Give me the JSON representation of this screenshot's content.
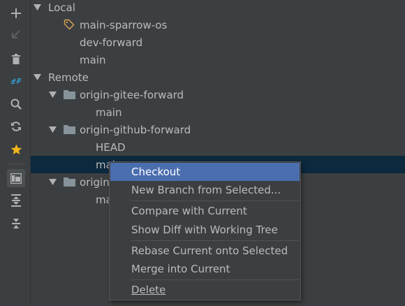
{
  "toolbar": {
    "buttons": [
      {
        "icon": "plus-icon"
      },
      {
        "icon": "arrow-down-left-icon"
      },
      {
        "icon": "trash-icon"
      },
      {
        "icon": "fetch-icon"
      },
      {
        "icon": "search-icon"
      },
      {
        "icon": "refresh-icon"
      },
      {
        "icon": "star-icon"
      },
      {
        "icon": "group-by-repository-icon"
      },
      {
        "icon": "expand-all-icon"
      },
      {
        "icon": "collapse-all-icon"
      }
    ]
  },
  "tree": {
    "local": {
      "label": "Local",
      "branches": [
        "main-sparrow-os",
        "dev-forward",
        "main"
      ]
    },
    "remote": {
      "label": "Remote",
      "groups": [
        {
          "name": "origin-gitee-forward",
          "branches": [
            "main"
          ]
        },
        {
          "name": "origin-github-forward",
          "branches": [
            "HEAD",
            "mai"
          ]
        },
        {
          "name": "origin",
          "branches": [
            "ma"
          ]
        }
      ]
    }
  },
  "context_menu": {
    "items": [
      {
        "label": "Checkout"
      },
      {
        "label": "New Branch from Selected..."
      },
      {
        "label": "Compare with Current"
      },
      {
        "label": "Show Diff with Working Tree"
      },
      {
        "label": "Rebase Current onto Selected"
      },
      {
        "label": "Merge into Current"
      },
      {
        "label": "Delete"
      }
    ]
  },
  "colors": {
    "background": "#3c3f41",
    "selection_row": "#0d293e",
    "menu_highlight": "#4b6eaf",
    "text": "#bbbbbb",
    "folder": "#87939a",
    "tag": "#d8a657",
    "fetch": "#3592c4",
    "star": "#f2b61b"
  }
}
